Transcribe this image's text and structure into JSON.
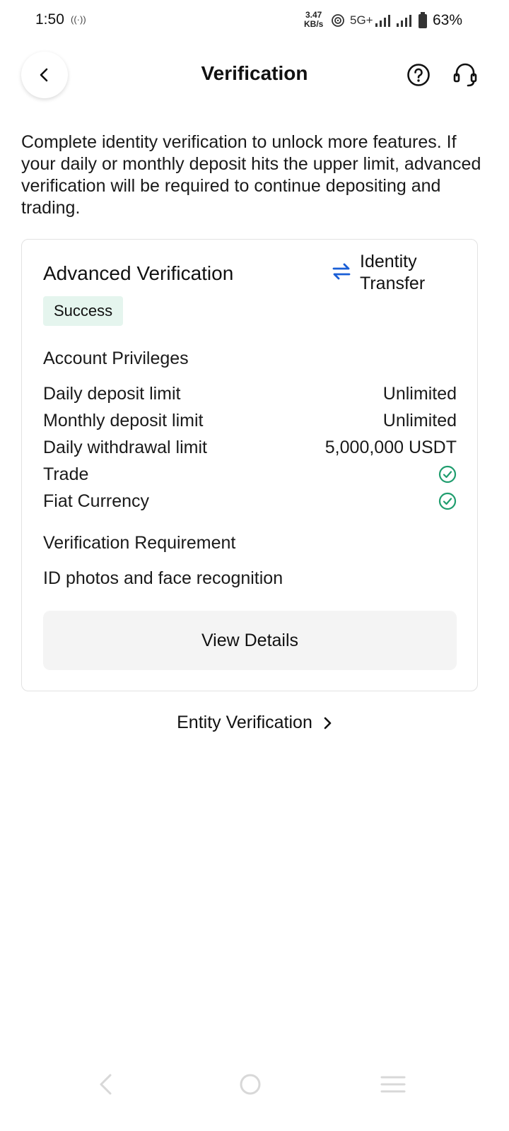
{
  "status_bar": {
    "time": "1:50",
    "speed_value": "3.47",
    "speed_unit": "KB/s",
    "network": "5G+",
    "battery": "63%"
  },
  "header": {
    "title": "Verification"
  },
  "intro_text": "Complete identity verification to unlock more features. If your daily or monthly deposit hits the upper limit, advanced verification will be required to continue depositing and trading.",
  "card": {
    "title": "Advanced Verification",
    "transfer_label_line1": "Identity",
    "transfer_label_line2": "Transfer",
    "status": "Success",
    "privileges_heading": "Account Privileges",
    "privileges": [
      {
        "label": "Daily deposit limit",
        "value": "Unlimited"
      },
      {
        "label": "Monthly deposit limit",
        "value": "Unlimited"
      },
      {
        "label": "Daily withdrawal limit",
        "value": "5,000,000 USDT"
      },
      {
        "label": "Trade",
        "value": null
      },
      {
        "label": "Fiat Currency",
        "value": null
      }
    ],
    "requirement_heading": "Verification Requirement",
    "requirement_text": "ID photos and face recognition",
    "view_button": "View Details"
  },
  "entity_link": "Entity Verification",
  "colors": {
    "accent_blue": "#1a5fd6",
    "success_green": "#1f9d6e",
    "badge_bg": "#e5f5ee"
  }
}
